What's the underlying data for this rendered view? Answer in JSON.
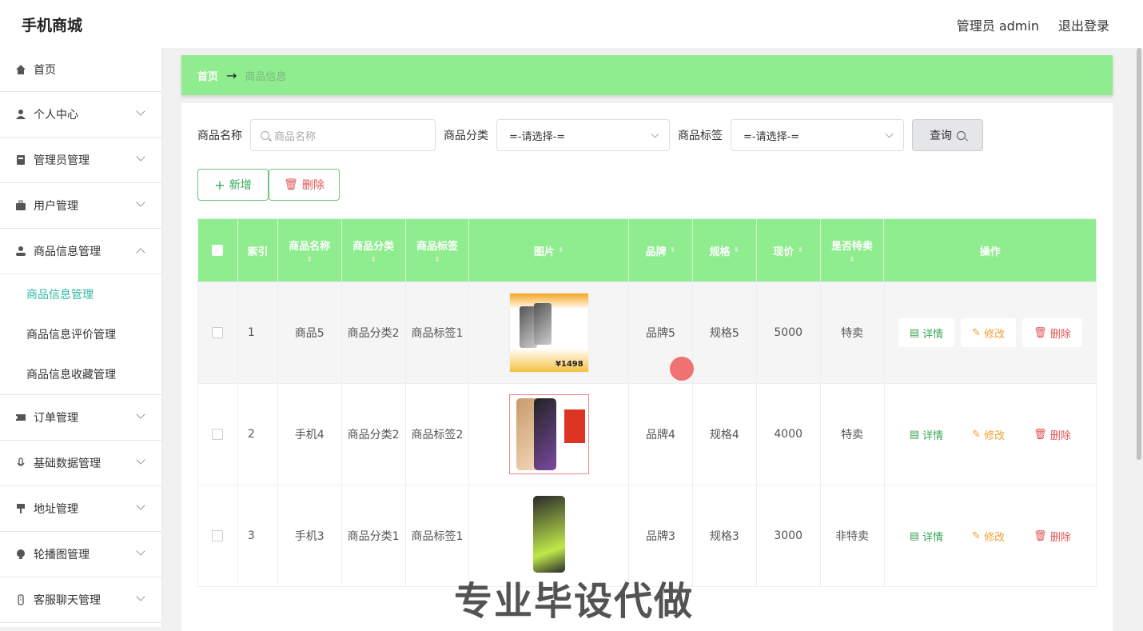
{
  "app": {
    "title": "手机商城"
  },
  "header": {
    "user_label": "管理员 admin",
    "logout_label": "退出登录"
  },
  "sidebar": {
    "items": [
      {
        "label": "首页",
        "icon": "home-icon"
      },
      {
        "label": "个人中心",
        "icon": "person-icon"
      },
      {
        "label": "管理员管理",
        "icon": "badge-icon"
      },
      {
        "label": "用户管理",
        "icon": "briefcase-icon"
      },
      {
        "label": "商品信息管理",
        "icon": "user-icon",
        "expanded": true
      }
    ],
    "subitems": [
      {
        "label": "商品信息管理",
        "active": true
      },
      {
        "label": "商品信息评价管理"
      },
      {
        "label": "商品信息收藏管理"
      }
    ],
    "items_after": [
      {
        "label": "订单管理",
        "icon": "ticket-icon"
      },
      {
        "label": "基础数据管理",
        "icon": "mic-icon"
      },
      {
        "label": "地址管理",
        "icon": "pin-icon"
      },
      {
        "label": "轮播图管理",
        "icon": "bulb-icon"
      },
      {
        "label": "客服聊天管理",
        "icon": "device-icon"
      }
    ]
  },
  "breadcrumb": {
    "home": "首页",
    "current": "商品信息"
  },
  "search": {
    "name_label": "商品名称",
    "name_placeholder": "商品名称",
    "category_label": "商品分类",
    "category_value": "=-请选择-=",
    "tag_label": "商品标签",
    "tag_value": "=-请选择-=",
    "query_label": "查询"
  },
  "actions": {
    "add_label": "新增",
    "delete_label": "删除"
  },
  "table": {
    "headers": {
      "index": "索引",
      "name": "商品名称",
      "category": "商品分类",
      "tag": "商品标签",
      "image": "图片",
      "brand": "品牌",
      "spec": "规格",
      "price": "现价",
      "special": "是否特卖",
      "ops": "操作"
    },
    "rows": [
      {
        "index": "1",
        "name": "商品5",
        "category": "商品分类2",
        "tag": "商品标签1",
        "brand": "品牌5",
        "spec": "规格5",
        "price": "5000",
        "special": "特卖",
        "img_text": "¥1498"
      },
      {
        "index": "2",
        "name": "手机4",
        "category": "商品分类2",
        "tag": "商品标签2",
        "brand": "品牌4",
        "spec": "规格4",
        "price": "4000",
        "special": "特卖"
      },
      {
        "index": "3",
        "name": "手机3",
        "category": "商品分类1",
        "tag": "商品标签1",
        "brand": "品牌3",
        "spec": "规格3",
        "price": "3000",
        "special": "非特卖"
      }
    ],
    "ops": {
      "detail": "详情",
      "edit": "修改",
      "delete": "删除"
    }
  },
  "watermark": "专业毕设代做"
}
